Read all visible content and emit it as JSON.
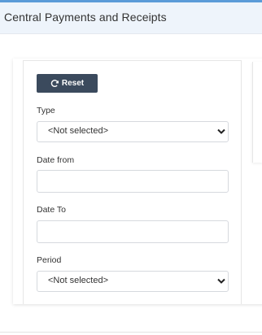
{
  "header": {
    "title": "Central Payments and Receipts"
  },
  "filters": {
    "reset_label": "Reset",
    "type": {
      "label": "Type",
      "value": "<Not selected>"
    },
    "date_from": {
      "label": "Date from",
      "value": ""
    },
    "date_to": {
      "label": "Date To",
      "value": ""
    },
    "period": {
      "label": "Period",
      "value": "<Not selected>"
    }
  },
  "icons": {
    "reset": "refresh-icon",
    "dropdown": "chevron-down-icon"
  },
  "colors": {
    "header_bg": "#eef4fb",
    "header_accent": "#5b9bd8",
    "button_bg": "#3b4a5d"
  }
}
